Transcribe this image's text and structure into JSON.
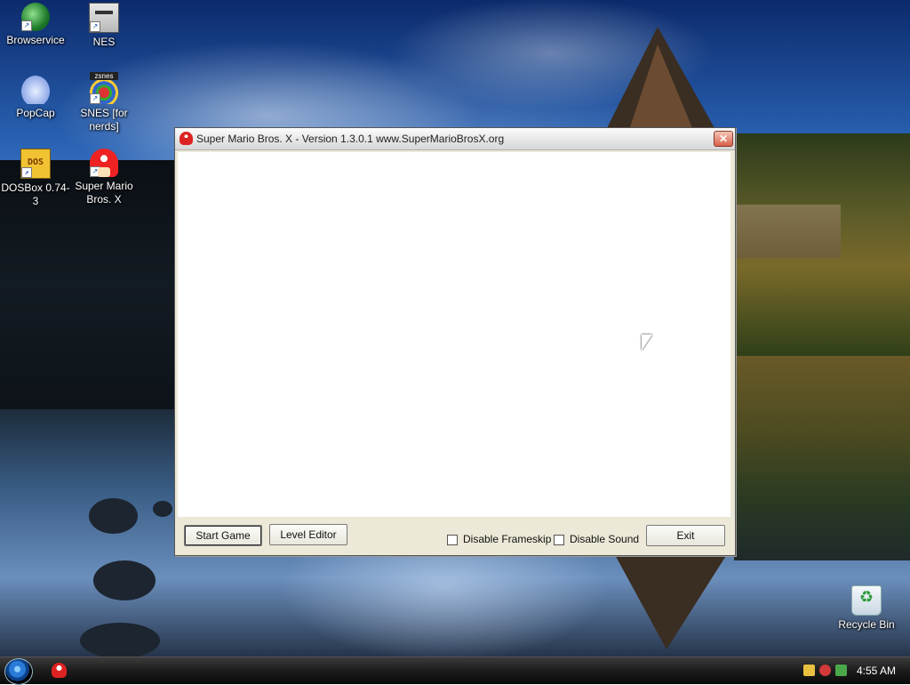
{
  "desktop": {
    "icons": [
      {
        "label": "Browservice",
        "icon": "browservice-icon"
      },
      {
        "label": "NES",
        "icon": "nes-icon"
      },
      {
        "label": "PopCap",
        "icon": "popcap-icon"
      },
      {
        "label": "SNES [for nerds]",
        "icon": "zsnes-icon"
      },
      {
        "label": "DOSBox 0.74-3",
        "icon": "dosbox-icon"
      },
      {
        "label": "Super Mario Bros. X",
        "icon": "mario-mushroom-icon"
      },
      {
        "label": "Recycle Bin",
        "icon": "recycle-bin-icon"
      }
    ],
    "dosbox_icon_text": "DOS"
  },
  "window": {
    "title": "Super Mario Bros. X - Version 1.3.0.1 www.SuperMarioBrosX.org",
    "close_label": "✕",
    "start_game_label": "Start Game",
    "level_editor_label": "Level Editor",
    "disable_frameskip_label": "Disable Frameskip",
    "disable_sound_label": "Disable Sound",
    "exit_label": "Exit"
  },
  "taskbar": {
    "clock": "4:55 AM"
  },
  "colors": {
    "window_bg": "#ece9d8",
    "close_button": "#d8604a",
    "taskbar": "#1c1c1c"
  }
}
